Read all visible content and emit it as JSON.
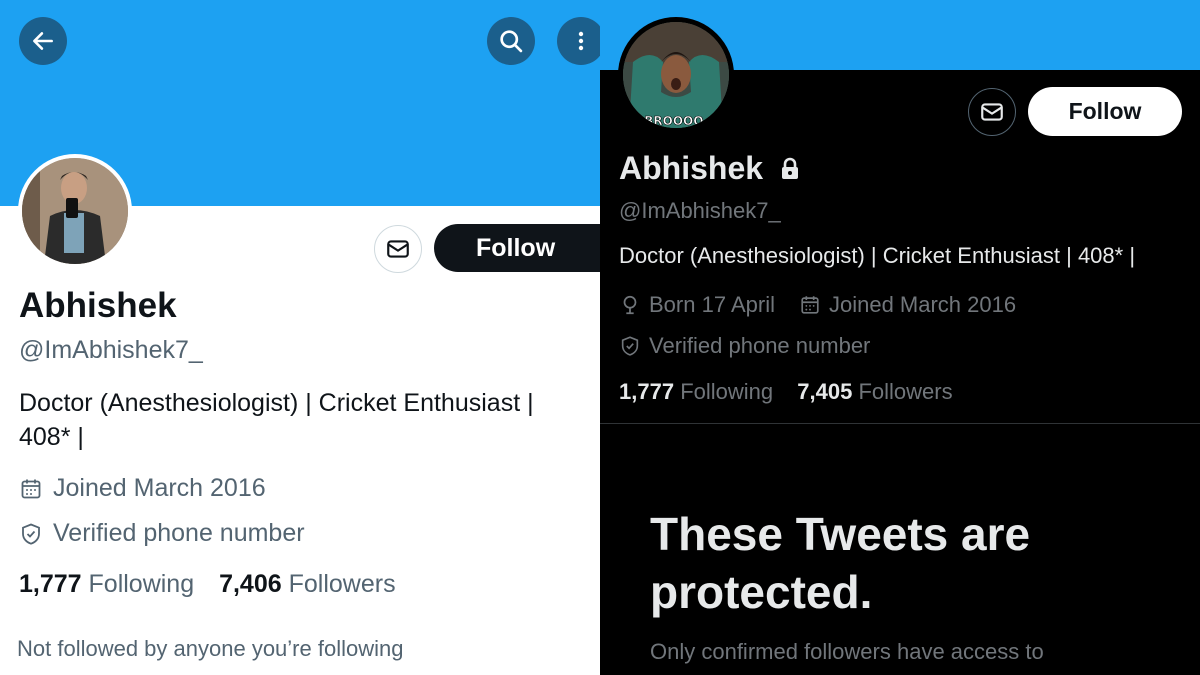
{
  "left": {
    "name": "Abhishek",
    "handle": "@ImAbhishek7_",
    "bio_line1": "Doctor (Anesthesiologist) | Cricket Enthusiast |",
    "bio_line2": "408* |",
    "joined": "Joined March 2016",
    "verified": "Verified phone number",
    "following_count": "1,777",
    "following_label": "Following",
    "followers_count": "7,406",
    "followers_label": "Followers",
    "not_followed": "Not followed by anyone you’re following",
    "follow_label": "Follow"
  },
  "right": {
    "name": "Abhishek",
    "handle": "@ImAbhishek7_",
    "bio": "Doctor (Anesthesiologist) | Cricket Enthusiast | 408* |",
    "born": "Born 17 April",
    "joined": "Joined March 2016",
    "verified": "Verified phone number",
    "following_count": "1,777",
    "following_label": "Following",
    "followers_count": "7,405",
    "followers_label": "Followers",
    "follow_label": "Follow",
    "avatar_text": "BROOOO.",
    "protected_title": "These Tweets are protected.",
    "protected_text": "Only confirmed followers have access to"
  },
  "colors": {
    "banner": "#1da1f2",
    "dark_bg": "#000000",
    "light_bg": "#ffffff",
    "secondary_text_light": "#536471",
    "secondary_text_dark": "#71767b"
  },
  "icons": [
    "back-arrow-icon",
    "search-icon",
    "more-vertical-icon",
    "mail-icon",
    "calendar-icon",
    "shield-check-icon",
    "location-pin-icon",
    "lock-icon"
  ]
}
